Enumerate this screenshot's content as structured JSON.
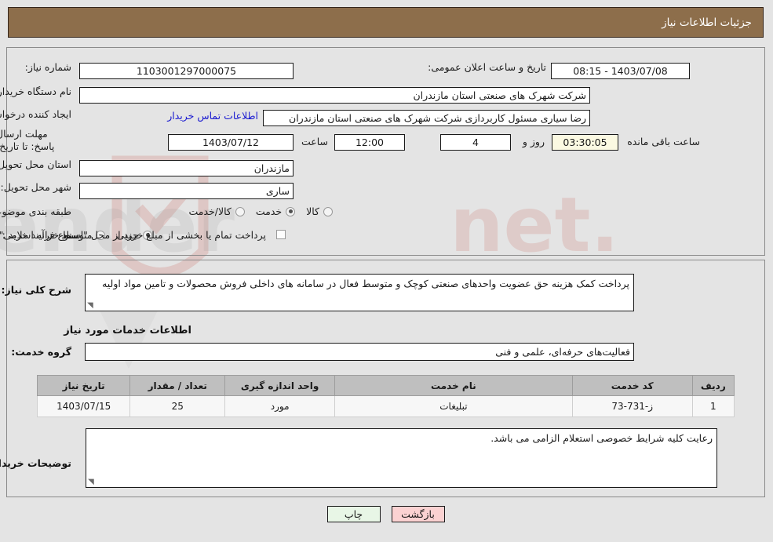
{
  "header": {
    "title": "جزئیات اطلاعات نیاز"
  },
  "colors": {
    "header_bg": "#8d6e4b",
    "header_text": "#ffffff",
    "page_bg": "#e4e4e4",
    "link": "#1919d0",
    "countdown_bg": "#fbf9e2",
    "table_header_bg": "#bfbfbf",
    "print_btn_bg": "#e8f6e6",
    "back_btn_bg": "#fbd2d2"
  },
  "top_panel": {
    "need_number_label": "شماره نیاز:",
    "need_number_value": "1103001297000075",
    "announce_datetime_label": "تاریخ و ساعت اعلان عمومی:",
    "announce_datetime_value": "1403/07/08 - 08:15",
    "buyer_org_label": "نام دستگاه خریدار:",
    "buyer_org_value": "شرکت شهرک های صنعتی استان مازندران",
    "requester_label": "ایجاد کننده درخواست:",
    "requester_value": "رضا سیاری مسئول کاربردازی شرکت شهرک های صنعتی استان مازندران",
    "contact_link": "اطلاعات تماس خریدار",
    "deadline_label": "مهلت ارسال پاسخ: تا تاریخ:",
    "deadline_date": "1403/07/12",
    "deadline_hour_label": "ساعت",
    "deadline_hour": "12:00",
    "remaining_days": "4",
    "remaining_days_label": "روز و",
    "remaining_time": "03:30:05",
    "remaining_time_label": "ساعت باقی مانده",
    "province_label": "استان محل تحویل:",
    "province_value": "مازندران",
    "city_label": "شهر محل تحویل:",
    "city_value": "ساری",
    "classification_label": "طبقه بندی موضوعی:",
    "classification_options": [
      {
        "label": "کالا",
        "selected": false
      },
      {
        "label": "خدمت",
        "selected": true
      },
      {
        "label": "کالا/خدمت",
        "selected": false
      }
    ],
    "process_type_label": "نوع فرآیند خرید :",
    "process_type_options": [
      {
        "label": "جزیی",
        "selected": true
      },
      {
        "label": "متوسط",
        "selected": false
      }
    ],
    "treasury_checkbox_checked": false,
    "treasury_note": "پرداخت تمام یا بخشی از مبلغ خرید،از محل \"اسناد خزانه اسلامی\" خواهد بود."
  },
  "mid_panel": {
    "general_desc_label": "شرح کلی نیاز:",
    "general_desc_value": "پرداخت کمک هزینه حق عضویت واحدهای صنعتی کوچک و متوسط فعال در سامانه های داخلی فروش محصولات و تامین مواد اولیه",
    "services_section_title": "اطلاعات خدمات مورد نیاز",
    "service_group_label": "گروه خدمت:",
    "service_group_value": "فعالیت‌های حرفه‌ای، علمی و فنی",
    "table": {
      "headers": [
        "ردیف",
        "کد خدمت",
        "نام خدمت",
        "واحد اندازه گیری",
        "تعداد / مقدار",
        "تاریخ نیاز"
      ],
      "rows": [
        [
          "1",
          "ز-731-73",
          "تبلیغات",
          "مورد",
          "25",
          "1403/07/15"
        ]
      ]
    },
    "buyer_notes_label": "توضیحات خریدار:",
    "buyer_notes_value": "رعایت کلیه شرایط خصوصی استعلام الزامی می باشد."
  },
  "footer": {
    "print_label": "چاپ",
    "back_label": "بازگشت"
  },
  "watermark": {
    "text": "AriaTender.net"
  }
}
